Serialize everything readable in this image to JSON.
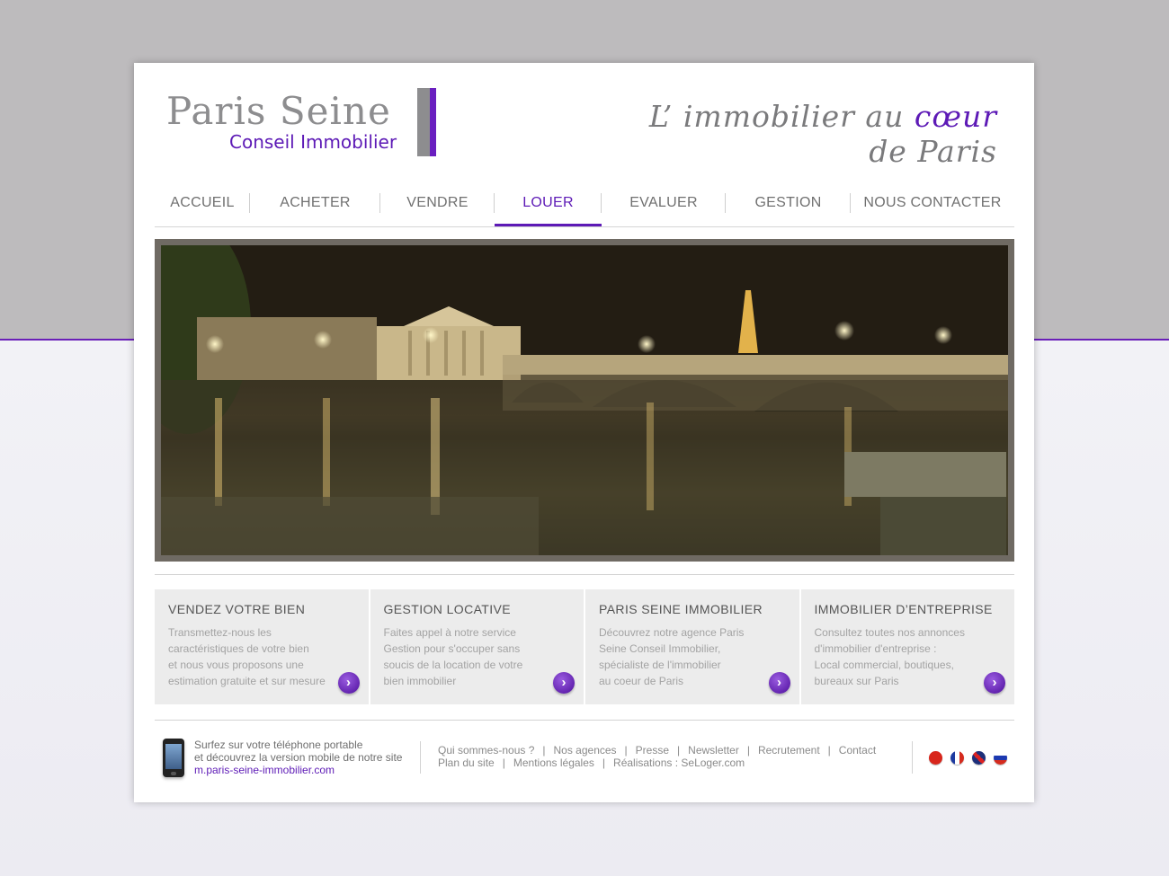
{
  "colors": {
    "brand_purple": "#5d1ab6",
    "brand_grey": "#8d8d8f",
    "nav_text": "#707070",
    "feature_bg": "#ececec"
  },
  "logo": {
    "name": "Paris Seine",
    "subtitle": "Conseil Immobilier"
  },
  "slogan": {
    "before": "L’ immobilier au ",
    "accent": "cœur",
    "after": " de Paris"
  },
  "nav": {
    "items": [
      {
        "label": "ACCUEIL"
      },
      {
        "label": "ACHETER"
      },
      {
        "label": "VENDRE"
      },
      {
        "label": "LOUER"
      },
      {
        "label": "EVALUER"
      },
      {
        "label": "GESTION"
      },
      {
        "label": "NOUS CONTACTER"
      }
    ],
    "active": "LOUER"
  },
  "features": [
    {
      "title": "VENDEZ VOTRE BIEN",
      "text": "Transmettez-nous les\ncaractéristiques de votre bien\net nous vous proposons une\nestimation gratuite et sur mesure",
      "arrow_icon": "chevron-right-icon"
    },
    {
      "title": "GESTION LOCATIVE",
      "text": "Faites appel à notre service\nGestion pour s'occuper sans\nsoucis de la location de votre\nbien immobilier",
      "arrow_icon": "chevron-right-icon"
    },
    {
      "title": "PARIS SEINE IMMOBILIER",
      "text": "Découvrez notre agence Paris\nSeine Conseil Immobilier,\nspécialiste de l'immobilier\nau coeur de Paris",
      "arrow_icon": "chevron-right-icon"
    },
    {
      "title": "IMMOBILIER D’ENTREPRISE",
      "text": "Consultez  toutes nos annonces\nd'immobilier d'entreprise :\nLocal commercial, boutiques,\nbureaux sur Paris",
      "arrow_icon": "chevron-right-icon"
    }
  ],
  "footer": {
    "mobile": {
      "line1": "Surfez sur votre téléphone portable",
      "line2": "et découvrez la version mobile de notre site",
      "link": "m.paris-seine-immobilier.com"
    },
    "links_row1": [
      "Qui sommes-nous ?",
      "Nos agences",
      "Presse",
      "Newsletter",
      "Recrutement",
      "Contact"
    ],
    "links_row2": [
      "Plan du site",
      "Mentions légales",
      "Réalisations : SeLoger.com"
    ],
    "flags": [
      "cn-flag-icon",
      "fr-flag-icon",
      "uk-flag-icon",
      "ru-flag-icon"
    ]
  }
}
